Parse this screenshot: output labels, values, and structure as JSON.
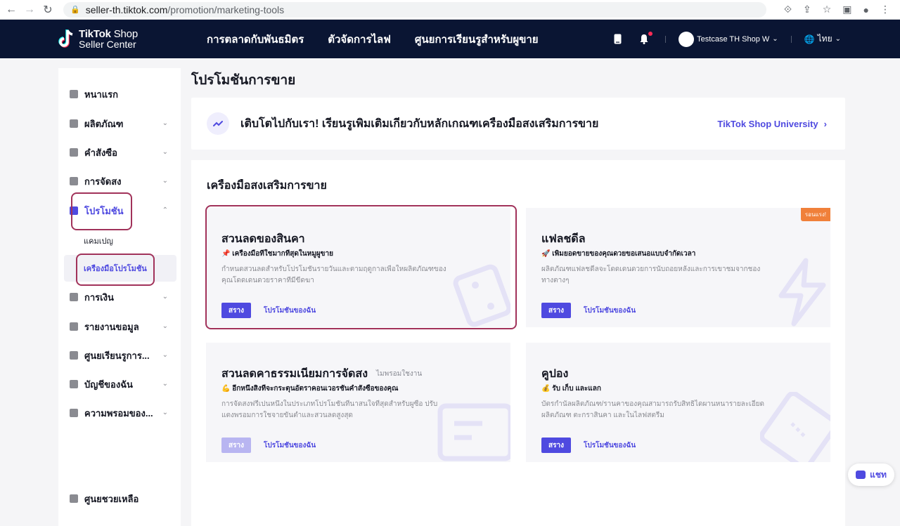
{
  "browser": {
    "url_host": "seller-th.tiktok.com",
    "url_path": "/promotion/marketing-tools"
  },
  "header": {
    "logo_line1_bold": "TikTok",
    "logo_line1_light": "Shop",
    "logo_line2": "Seller Center",
    "nav": [
      "การตลาดกับพันธมิตร",
      "ตัวจัดการไลฟ",
      "ศูนยการเรียนรูสำหรับผูขาย"
    ],
    "user_name": "Testcase TH Shop W",
    "language": "ไทย"
  },
  "sidebar": {
    "items": [
      {
        "label": "หนาแรก"
      },
      {
        "label": "ผลิตภัณฑ"
      },
      {
        "label": "คำสังซือ"
      },
      {
        "label": "การจัดสง"
      },
      {
        "label": "โปรโมชัน"
      },
      {
        "label": "การเงิน"
      },
      {
        "label": "รายงานขอมูล"
      },
      {
        "label": "ศูนยเรียนรูการ..."
      },
      {
        "label": "บัญชีของฉัน"
      },
      {
        "label": "ความพรอมของ..."
      }
    ],
    "sub_items": [
      "แคมเปญ",
      "เครืองมือโปรโมชัน"
    ],
    "help": "ศูนยชวยเหลือ"
  },
  "main": {
    "page_title": "โปรโมชันการขาย",
    "banner_text": "เติบโตไปกับเรา! เรียนรูเพิมเติมเกียวกับหลักเกณฑเครืองมือสงเสริมการขาย",
    "banner_link": "TikTok Shop University",
    "tools_title": "เครืองมือสงเสริมการขาย",
    "cards": [
      {
        "title": "สวนลดของสินคา",
        "subtitle": "📌 เครืองมือทีใชมากทีสุดในหมูผูขาย",
        "desc": "กำหนดสวนลดสำหรับโปรโมชันรายวันและตามฤดูกาลเพือใหผลิตภัณฑของคุณโดดเดนดวยราคาทีมีขีดฆา",
        "create": "สราง",
        "mine": "โปรโมชันของฉัน"
      },
      {
        "title": "แฟลชดีล",
        "badge": "รอนแรง!",
        "subtitle": "🚀 เพิมยอดขายของคุณดวยขอเสนอแบบจำกัดเวลา",
        "desc": "ผลิตภัณฑแฟลชดีลจะโดดเดนดวยการนับถอยหลังและการเขาชมจากชองทางตางๆ",
        "create": "สราง",
        "mine": "โปรโมชันของฉัน"
      },
      {
        "title": "สวนลดคาธรรมเนียมการจัดสง",
        "status": "ไมพรอมใชงาน",
        "subtitle": "💪 อีกหนึงสิงทีจะกระตุนอัตราคอนเวอรชันคำสังซือของคุณ",
        "desc": "การจัดสงฟรีเปนหนึงในประเภทโปรโมชันทีนาสนใจทีสุดสำหรับผูซือ ปรับแตงพรอมการใชจายขันตำและสวนลดสูงสุด",
        "create": "สราง",
        "mine": "โปรโมชันของฉัน"
      },
      {
        "title": "คูปอง",
        "subtitle": "💰 รับ เก็บ และแลก",
        "desc": "บัตรกำนัลผลิตภัณฑ/รานคาของคุณสามารถรับสิทธิไดผานหนารายละเอียดผลิตภัณฑ ตะกราสินคา และในไลฟสตรีม",
        "create": "สราง",
        "mine": "โปรโมชันของฉัน"
      }
    ]
  },
  "chat": {
    "label": "แชท"
  },
  "colors": {
    "accent": "#4f4ae0",
    "header_bg": "#0a1533",
    "highlight": "#a1325a",
    "badge": "#f0803a"
  }
}
